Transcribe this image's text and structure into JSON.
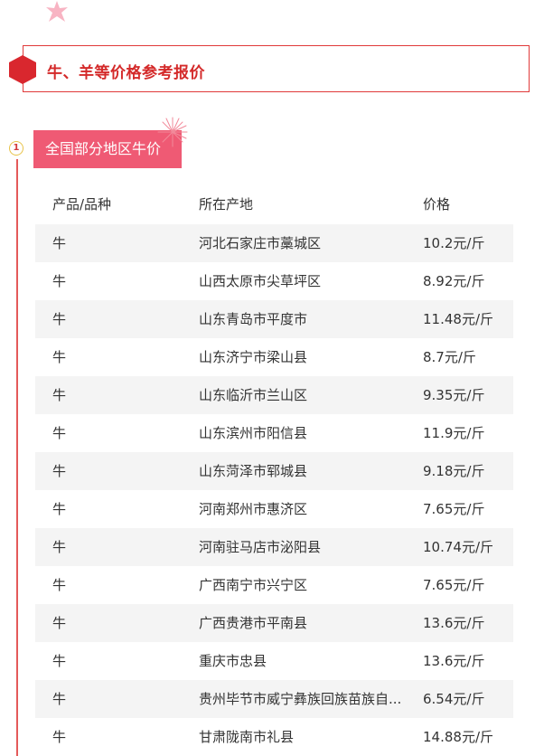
{
  "page": {
    "title": "牛、羊等价格参考报价",
    "accent_color": "#e03a3a"
  },
  "section": {
    "number": "1",
    "tag": "全国部分地区牛价",
    "tag_color": "#ef5a74"
  },
  "table": {
    "headers": [
      "产品/品种",
      "所在产地",
      "价格"
    ],
    "rows": [
      {
        "product": "牛",
        "origin": "河北石家庄市藁城区",
        "price": "10.2元/斤"
      },
      {
        "product": "牛",
        "origin": "山西太原市尖草坪区",
        "price": "8.92元/斤"
      },
      {
        "product": "牛",
        "origin": "山东青岛市平度市",
        "price": "11.48元/斤"
      },
      {
        "product": "牛",
        "origin": "山东济宁市梁山县",
        "price": "8.7元/斤"
      },
      {
        "product": "牛",
        "origin": "山东临沂市兰山区",
        "price": "9.35元/斤"
      },
      {
        "product": "牛",
        "origin": "山东滨州市阳信县",
        "price": "11.9元/斤"
      },
      {
        "product": "牛",
        "origin": "山东菏泽市郓城县",
        "price": "9.18元/斤"
      },
      {
        "product": "牛",
        "origin": "河南郑州市惠济区",
        "price": "7.65元/斤"
      },
      {
        "product": "牛",
        "origin": "河南驻马店市泌阳县",
        "price": "10.74元/斤"
      },
      {
        "product": "牛",
        "origin": "广西南宁市兴宁区",
        "price": "7.65元/斤"
      },
      {
        "product": "牛",
        "origin": "广西贵港市平南县",
        "price": "13.6元/斤"
      },
      {
        "product": "牛",
        "origin": "重庆市忠县",
        "price": "13.6元/斤"
      },
      {
        "product": "牛",
        "origin": "贵州毕节市威宁彝族回族苗族自...",
        "price": "6.54元/斤"
      },
      {
        "product": "牛",
        "origin": "甘肃陇南市礼县",
        "price": "14.88元/斤"
      }
    ]
  },
  "icons": {
    "top_decoration": "starfish-icon",
    "title_marker": "hexagon-icon",
    "section_decoration": "firework-icon"
  }
}
